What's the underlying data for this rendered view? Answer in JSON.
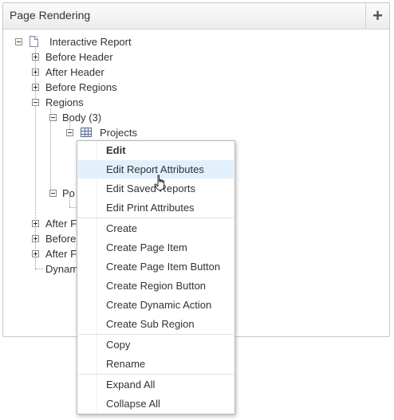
{
  "panel": {
    "title": "Page Rendering",
    "add_icon": "plus-icon"
  },
  "tree": {
    "root": "Interactive Report",
    "before_header": "Before Header",
    "after_header": "After Header",
    "before_regions": "Before Regions",
    "regions": "Regions",
    "body": "Body (3)",
    "projects": "Projects",
    "post_partial": "Po",
    "after_r_partial": "After F",
    "before_partial": "Before",
    "after_f_partial": "After F",
    "dynamic_partial": "Dynam"
  },
  "context_menu": {
    "items": [
      {
        "label": "Edit"
      },
      {
        "label": "Edit Report Attributes"
      },
      {
        "label": "Edit Saved Reports"
      },
      {
        "label": "Edit Print Attributes"
      },
      {
        "label": "Create"
      },
      {
        "label": "Create Page Item"
      },
      {
        "label": "Create Page Item Button"
      },
      {
        "label": "Create Region Button"
      },
      {
        "label": "Create Dynamic Action"
      },
      {
        "label": "Create Sub Region"
      },
      {
        "label": "Copy"
      },
      {
        "label": "Rename"
      },
      {
        "label": "Expand All"
      },
      {
        "label": "Collapse All"
      }
    ],
    "hovered_item": "Edit Report Attributes"
  },
  "colors": {
    "hover_background": "#e2f0fb",
    "panel_border": "#c8c8c8"
  }
}
